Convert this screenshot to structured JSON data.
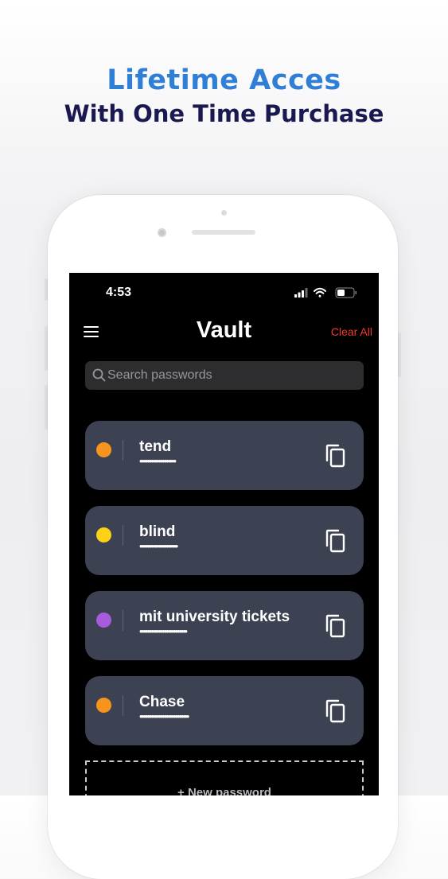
{
  "promo": {
    "headline": "Lifetime Acces",
    "subheadline": "With One Time Purchase"
  },
  "colors": {
    "headline": "#2f7fd6",
    "subheadline": "#1a1850",
    "accent_danger": "#ee3b2e",
    "card_background": "#3c4252",
    "screen_background": "#000000"
  },
  "status_bar": {
    "time": "4:53",
    "icons": [
      "signal-icon",
      "wifi-icon",
      "battery-icon"
    ]
  },
  "header": {
    "menu_icon": "hamburger-menu-icon",
    "title": "Vault",
    "clear_all_label": "Clear All"
  },
  "search": {
    "placeholder": "Search passwords",
    "value": "",
    "icon": "search-icon"
  },
  "vault_items": [
    {
      "name": "tend",
      "masked": "•••••••••••••••••••",
      "dot_color": "#f7941d",
      "action_icon": "copy-icon"
    },
    {
      "name": "blind",
      "masked": "••••••••••••••••••••",
      "dot_color": "#fcd116",
      "action_icon": "copy-icon"
    },
    {
      "name": "mit university tickets",
      "masked": "•••••••••••••••••••••••••",
      "dot_color": "#a85bdc",
      "action_icon": "copy-icon"
    },
    {
      "name": "Chase",
      "masked": "••••••••••••••••••••••••••",
      "dot_color": "#f7941d",
      "action_icon": "copy-icon"
    }
  ],
  "new_password": {
    "label": "+ New password"
  }
}
